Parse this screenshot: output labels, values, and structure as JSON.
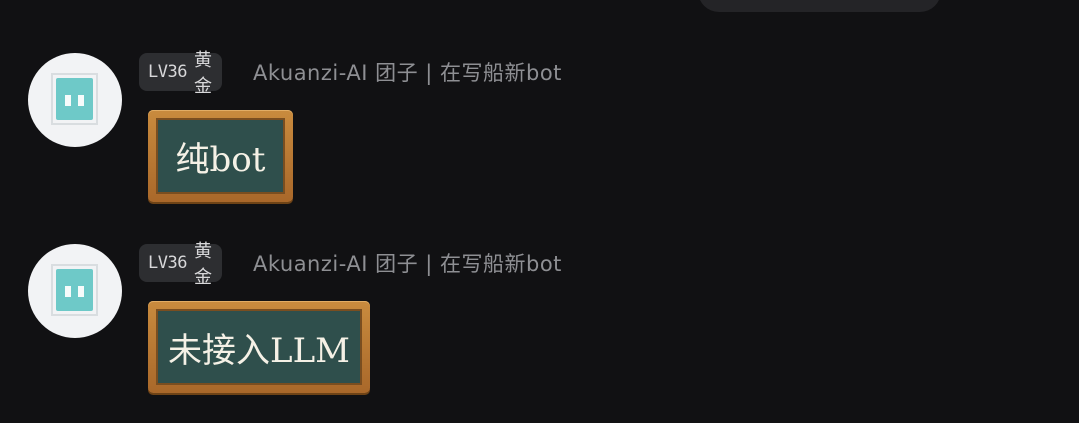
{
  "messages": [
    {
      "badge": {
        "level": "LV36",
        "rank": "黄金"
      },
      "username": "Akuanzi-AI 团子 | 在写船新bot",
      "content": "纯bot"
    },
    {
      "badge": {
        "level": "LV36",
        "rank": "黄金"
      },
      "username": "Akuanzi-AI 团子 | 在写船新bot",
      "content": "未接入LLM"
    }
  ],
  "colors": {
    "background": "#111113",
    "board": "#2f4f4c",
    "frame": "#c98b3e",
    "avatar_accent": "#6ec9c8"
  }
}
